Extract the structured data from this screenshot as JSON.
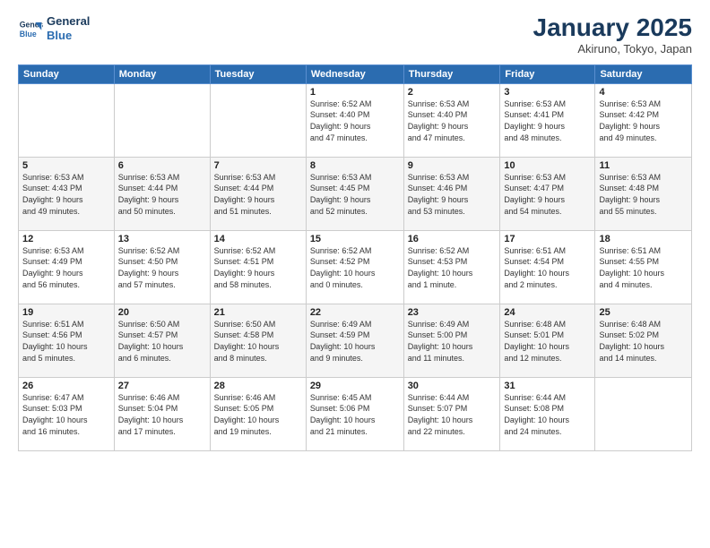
{
  "logo": {
    "line1": "General",
    "line2": "Blue"
  },
  "title": "January 2025",
  "location": "Akiruno, Tokyo, Japan",
  "weekdays": [
    "Sunday",
    "Monday",
    "Tuesday",
    "Wednesday",
    "Thursday",
    "Friday",
    "Saturday"
  ],
  "weeks": [
    [
      {
        "day": "",
        "info": ""
      },
      {
        "day": "",
        "info": ""
      },
      {
        "day": "",
        "info": ""
      },
      {
        "day": "1",
        "info": "Sunrise: 6:52 AM\nSunset: 4:40 PM\nDaylight: 9 hours\nand 47 minutes."
      },
      {
        "day": "2",
        "info": "Sunrise: 6:53 AM\nSunset: 4:40 PM\nDaylight: 9 hours\nand 47 minutes."
      },
      {
        "day": "3",
        "info": "Sunrise: 6:53 AM\nSunset: 4:41 PM\nDaylight: 9 hours\nand 48 minutes."
      },
      {
        "day": "4",
        "info": "Sunrise: 6:53 AM\nSunset: 4:42 PM\nDaylight: 9 hours\nand 49 minutes."
      }
    ],
    [
      {
        "day": "5",
        "info": "Sunrise: 6:53 AM\nSunset: 4:43 PM\nDaylight: 9 hours\nand 49 minutes."
      },
      {
        "day": "6",
        "info": "Sunrise: 6:53 AM\nSunset: 4:44 PM\nDaylight: 9 hours\nand 50 minutes."
      },
      {
        "day": "7",
        "info": "Sunrise: 6:53 AM\nSunset: 4:44 PM\nDaylight: 9 hours\nand 51 minutes."
      },
      {
        "day": "8",
        "info": "Sunrise: 6:53 AM\nSunset: 4:45 PM\nDaylight: 9 hours\nand 52 minutes."
      },
      {
        "day": "9",
        "info": "Sunrise: 6:53 AM\nSunset: 4:46 PM\nDaylight: 9 hours\nand 53 minutes."
      },
      {
        "day": "10",
        "info": "Sunrise: 6:53 AM\nSunset: 4:47 PM\nDaylight: 9 hours\nand 54 minutes."
      },
      {
        "day": "11",
        "info": "Sunrise: 6:53 AM\nSunset: 4:48 PM\nDaylight: 9 hours\nand 55 minutes."
      }
    ],
    [
      {
        "day": "12",
        "info": "Sunrise: 6:53 AM\nSunset: 4:49 PM\nDaylight: 9 hours\nand 56 minutes."
      },
      {
        "day": "13",
        "info": "Sunrise: 6:52 AM\nSunset: 4:50 PM\nDaylight: 9 hours\nand 57 minutes."
      },
      {
        "day": "14",
        "info": "Sunrise: 6:52 AM\nSunset: 4:51 PM\nDaylight: 9 hours\nand 58 minutes."
      },
      {
        "day": "15",
        "info": "Sunrise: 6:52 AM\nSunset: 4:52 PM\nDaylight: 10 hours\nand 0 minutes."
      },
      {
        "day": "16",
        "info": "Sunrise: 6:52 AM\nSunset: 4:53 PM\nDaylight: 10 hours\nand 1 minute."
      },
      {
        "day": "17",
        "info": "Sunrise: 6:51 AM\nSunset: 4:54 PM\nDaylight: 10 hours\nand 2 minutes."
      },
      {
        "day": "18",
        "info": "Sunrise: 6:51 AM\nSunset: 4:55 PM\nDaylight: 10 hours\nand 4 minutes."
      }
    ],
    [
      {
        "day": "19",
        "info": "Sunrise: 6:51 AM\nSunset: 4:56 PM\nDaylight: 10 hours\nand 5 minutes."
      },
      {
        "day": "20",
        "info": "Sunrise: 6:50 AM\nSunset: 4:57 PM\nDaylight: 10 hours\nand 6 minutes."
      },
      {
        "day": "21",
        "info": "Sunrise: 6:50 AM\nSunset: 4:58 PM\nDaylight: 10 hours\nand 8 minutes."
      },
      {
        "day": "22",
        "info": "Sunrise: 6:49 AM\nSunset: 4:59 PM\nDaylight: 10 hours\nand 9 minutes."
      },
      {
        "day": "23",
        "info": "Sunrise: 6:49 AM\nSunset: 5:00 PM\nDaylight: 10 hours\nand 11 minutes."
      },
      {
        "day": "24",
        "info": "Sunrise: 6:48 AM\nSunset: 5:01 PM\nDaylight: 10 hours\nand 12 minutes."
      },
      {
        "day": "25",
        "info": "Sunrise: 6:48 AM\nSunset: 5:02 PM\nDaylight: 10 hours\nand 14 minutes."
      }
    ],
    [
      {
        "day": "26",
        "info": "Sunrise: 6:47 AM\nSunset: 5:03 PM\nDaylight: 10 hours\nand 16 minutes."
      },
      {
        "day": "27",
        "info": "Sunrise: 6:46 AM\nSunset: 5:04 PM\nDaylight: 10 hours\nand 17 minutes."
      },
      {
        "day": "28",
        "info": "Sunrise: 6:46 AM\nSunset: 5:05 PM\nDaylight: 10 hours\nand 19 minutes."
      },
      {
        "day": "29",
        "info": "Sunrise: 6:45 AM\nSunset: 5:06 PM\nDaylight: 10 hours\nand 21 minutes."
      },
      {
        "day": "30",
        "info": "Sunrise: 6:44 AM\nSunset: 5:07 PM\nDaylight: 10 hours\nand 22 minutes."
      },
      {
        "day": "31",
        "info": "Sunrise: 6:44 AM\nSunset: 5:08 PM\nDaylight: 10 hours\nand 24 minutes."
      },
      {
        "day": "",
        "info": ""
      }
    ]
  ]
}
